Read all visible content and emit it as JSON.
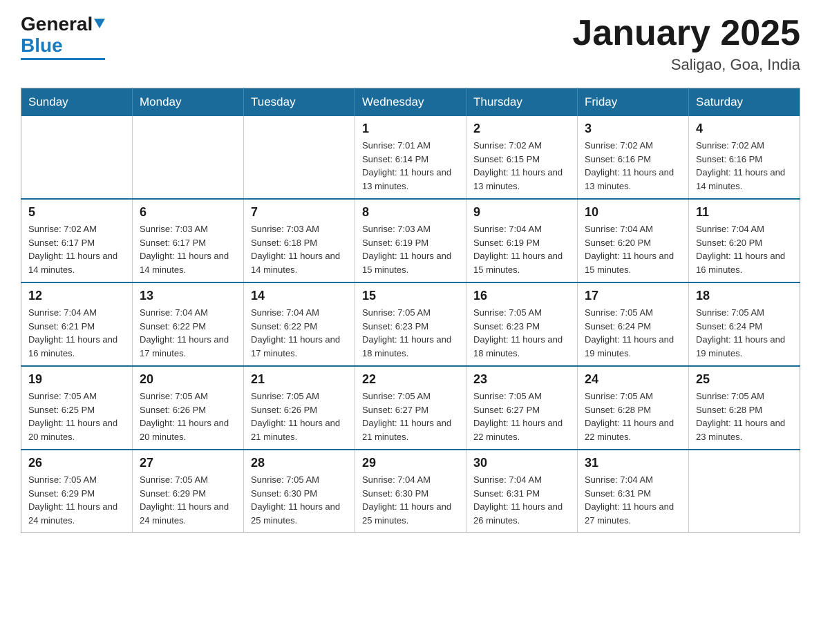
{
  "logo": {
    "general": "General",
    "blue": "Blue"
  },
  "header": {
    "title": "January 2025",
    "subtitle": "Saligao, Goa, India"
  },
  "calendar": {
    "weekdays": [
      "Sunday",
      "Monday",
      "Tuesday",
      "Wednesday",
      "Thursday",
      "Friday",
      "Saturday"
    ],
    "weeks": [
      [
        {
          "day": "",
          "info": ""
        },
        {
          "day": "",
          "info": ""
        },
        {
          "day": "",
          "info": ""
        },
        {
          "day": "1",
          "info": "Sunrise: 7:01 AM\nSunset: 6:14 PM\nDaylight: 11 hours and 13 minutes."
        },
        {
          "day": "2",
          "info": "Sunrise: 7:02 AM\nSunset: 6:15 PM\nDaylight: 11 hours and 13 minutes."
        },
        {
          "day": "3",
          "info": "Sunrise: 7:02 AM\nSunset: 6:16 PM\nDaylight: 11 hours and 13 minutes."
        },
        {
          "day": "4",
          "info": "Sunrise: 7:02 AM\nSunset: 6:16 PM\nDaylight: 11 hours and 14 minutes."
        }
      ],
      [
        {
          "day": "5",
          "info": "Sunrise: 7:02 AM\nSunset: 6:17 PM\nDaylight: 11 hours and 14 minutes."
        },
        {
          "day": "6",
          "info": "Sunrise: 7:03 AM\nSunset: 6:17 PM\nDaylight: 11 hours and 14 minutes."
        },
        {
          "day": "7",
          "info": "Sunrise: 7:03 AM\nSunset: 6:18 PM\nDaylight: 11 hours and 14 minutes."
        },
        {
          "day": "8",
          "info": "Sunrise: 7:03 AM\nSunset: 6:19 PM\nDaylight: 11 hours and 15 minutes."
        },
        {
          "day": "9",
          "info": "Sunrise: 7:04 AM\nSunset: 6:19 PM\nDaylight: 11 hours and 15 minutes."
        },
        {
          "day": "10",
          "info": "Sunrise: 7:04 AM\nSunset: 6:20 PM\nDaylight: 11 hours and 15 minutes."
        },
        {
          "day": "11",
          "info": "Sunrise: 7:04 AM\nSunset: 6:20 PM\nDaylight: 11 hours and 16 minutes."
        }
      ],
      [
        {
          "day": "12",
          "info": "Sunrise: 7:04 AM\nSunset: 6:21 PM\nDaylight: 11 hours and 16 minutes."
        },
        {
          "day": "13",
          "info": "Sunrise: 7:04 AM\nSunset: 6:22 PM\nDaylight: 11 hours and 17 minutes."
        },
        {
          "day": "14",
          "info": "Sunrise: 7:04 AM\nSunset: 6:22 PM\nDaylight: 11 hours and 17 minutes."
        },
        {
          "day": "15",
          "info": "Sunrise: 7:05 AM\nSunset: 6:23 PM\nDaylight: 11 hours and 18 minutes."
        },
        {
          "day": "16",
          "info": "Sunrise: 7:05 AM\nSunset: 6:23 PM\nDaylight: 11 hours and 18 minutes."
        },
        {
          "day": "17",
          "info": "Sunrise: 7:05 AM\nSunset: 6:24 PM\nDaylight: 11 hours and 19 minutes."
        },
        {
          "day": "18",
          "info": "Sunrise: 7:05 AM\nSunset: 6:24 PM\nDaylight: 11 hours and 19 minutes."
        }
      ],
      [
        {
          "day": "19",
          "info": "Sunrise: 7:05 AM\nSunset: 6:25 PM\nDaylight: 11 hours and 20 minutes."
        },
        {
          "day": "20",
          "info": "Sunrise: 7:05 AM\nSunset: 6:26 PM\nDaylight: 11 hours and 20 minutes."
        },
        {
          "day": "21",
          "info": "Sunrise: 7:05 AM\nSunset: 6:26 PM\nDaylight: 11 hours and 21 minutes."
        },
        {
          "day": "22",
          "info": "Sunrise: 7:05 AM\nSunset: 6:27 PM\nDaylight: 11 hours and 21 minutes."
        },
        {
          "day": "23",
          "info": "Sunrise: 7:05 AM\nSunset: 6:27 PM\nDaylight: 11 hours and 22 minutes."
        },
        {
          "day": "24",
          "info": "Sunrise: 7:05 AM\nSunset: 6:28 PM\nDaylight: 11 hours and 22 minutes."
        },
        {
          "day": "25",
          "info": "Sunrise: 7:05 AM\nSunset: 6:28 PM\nDaylight: 11 hours and 23 minutes."
        }
      ],
      [
        {
          "day": "26",
          "info": "Sunrise: 7:05 AM\nSunset: 6:29 PM\nDaylight: 11 hours and 24 minutes."
        },
        {
          "day": "27",
          "info": "Sunrise: 7:05 AM\nSunset: 6:29 PM\nDaylight: 11 hours and 24 minutes."
        },
        {
          "day": "28",
          "info": "Sunrise: 7:05 AM\nSunset: 6:30 PM\nDaylight: 11 hours and 25 minutes."
        },
        {
          "day": "29",
          "info": "Sunrise: 7:04 AM\nSunset: 6:30 PM\nDaylight: 11 hours and 25 minutes."
        },
        {
          "day": "30",
          "info": "Sunrise: 7:04 AM\nSunset: 6:31 PM\nDaylight: 11 hours and 26 minutes."
        },
        {
          "day": "31",
          "info": "Sunrise: 7:04 AM\nSunset: 6:31 PM\nDaylight: 11 hours and 27 minutes."
        },
        {
          "day": "",
          "info": ""
        }
      ]
    ]
  }
}
